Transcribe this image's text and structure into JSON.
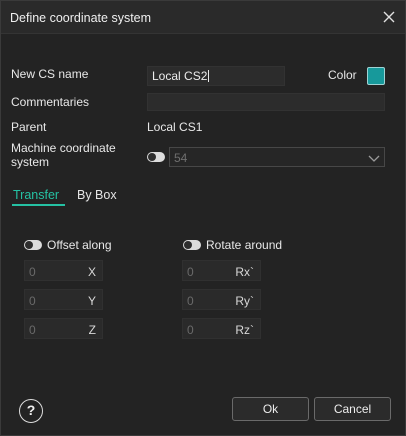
{
  "window": {
    "title": "Define coordinate system",
    "close_icon": "close-icon"
  },
  "form": {
    "new_cs_name_label": "New CS name",
    "new_cs_name_value": "Local CS2",
    "color_label": "Color",
    "color_value": "#17999b",
    "commentaries_label": "Commentaries",
    "commentaries_value": "",
    "parent_label": "Parent",
    "parent_value": "Local CS1",
    "machine_cs_label_line1": "Machine coordinate",
    "machine_cs_label_line2": "system",
    "machine_cs_toggle": false,
    "machine_cs_selected": "54"
  },
  "tabs": [
    {
      "label": "Transfer",
      "active": true
    },
    {
      "label": "By Box",
      "active": false
    }
  ],
  "offset": {
    "label": "Offset along",
    "enabled": false,
    "fields": [
      {
        "value": "0",
        "axis": "X"
      },
      {
        "value": "0",
        "axis": "Y"
      },
      {
        "value": "0",
        "axis": "Z"
      }
    ]
  },
  "rotate": {
    "label": "Rotate around",
    "enabled": false,
    "fields": [
      {
        "value": "0",
        "axis": "Rx`"
      },
      {
        "value": "0",
        "axis": "Ry`"
      },
      {
        "value": "0",
        "axis": "Rz`"
      }
    ]
  },
  "footer": {
    "help_label": "?",
    "ok_label": "Ok",
    "cancel_label": "Cancel"
  }
}
